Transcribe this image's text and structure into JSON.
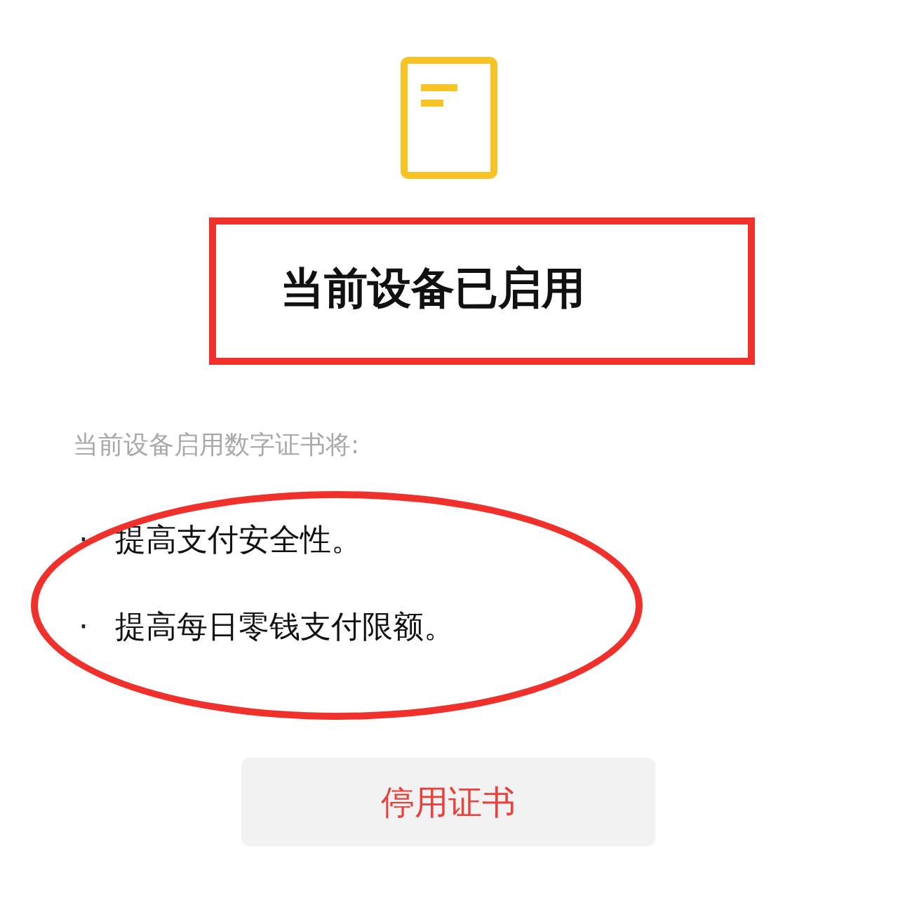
{
  "title": "当前设备已启用",
  "description": "当前设备启用数字证书将:",
  "benefits": [
    {
      "bullet": "·",
      "text": "提高支付安全性。"
    },
    {
      "bullet": "·",
      "text": "提高每日零钱支付限额。"
    }
  ],
  "button": {
    "label": "停用证书"
  },
  "annotations": [
    {
      "kind": "rectangle",
      "color": "#f0302b"
    },
    {
      "kind": "ellipse",
      "color": "#f0302b"
    }
  ]
}
